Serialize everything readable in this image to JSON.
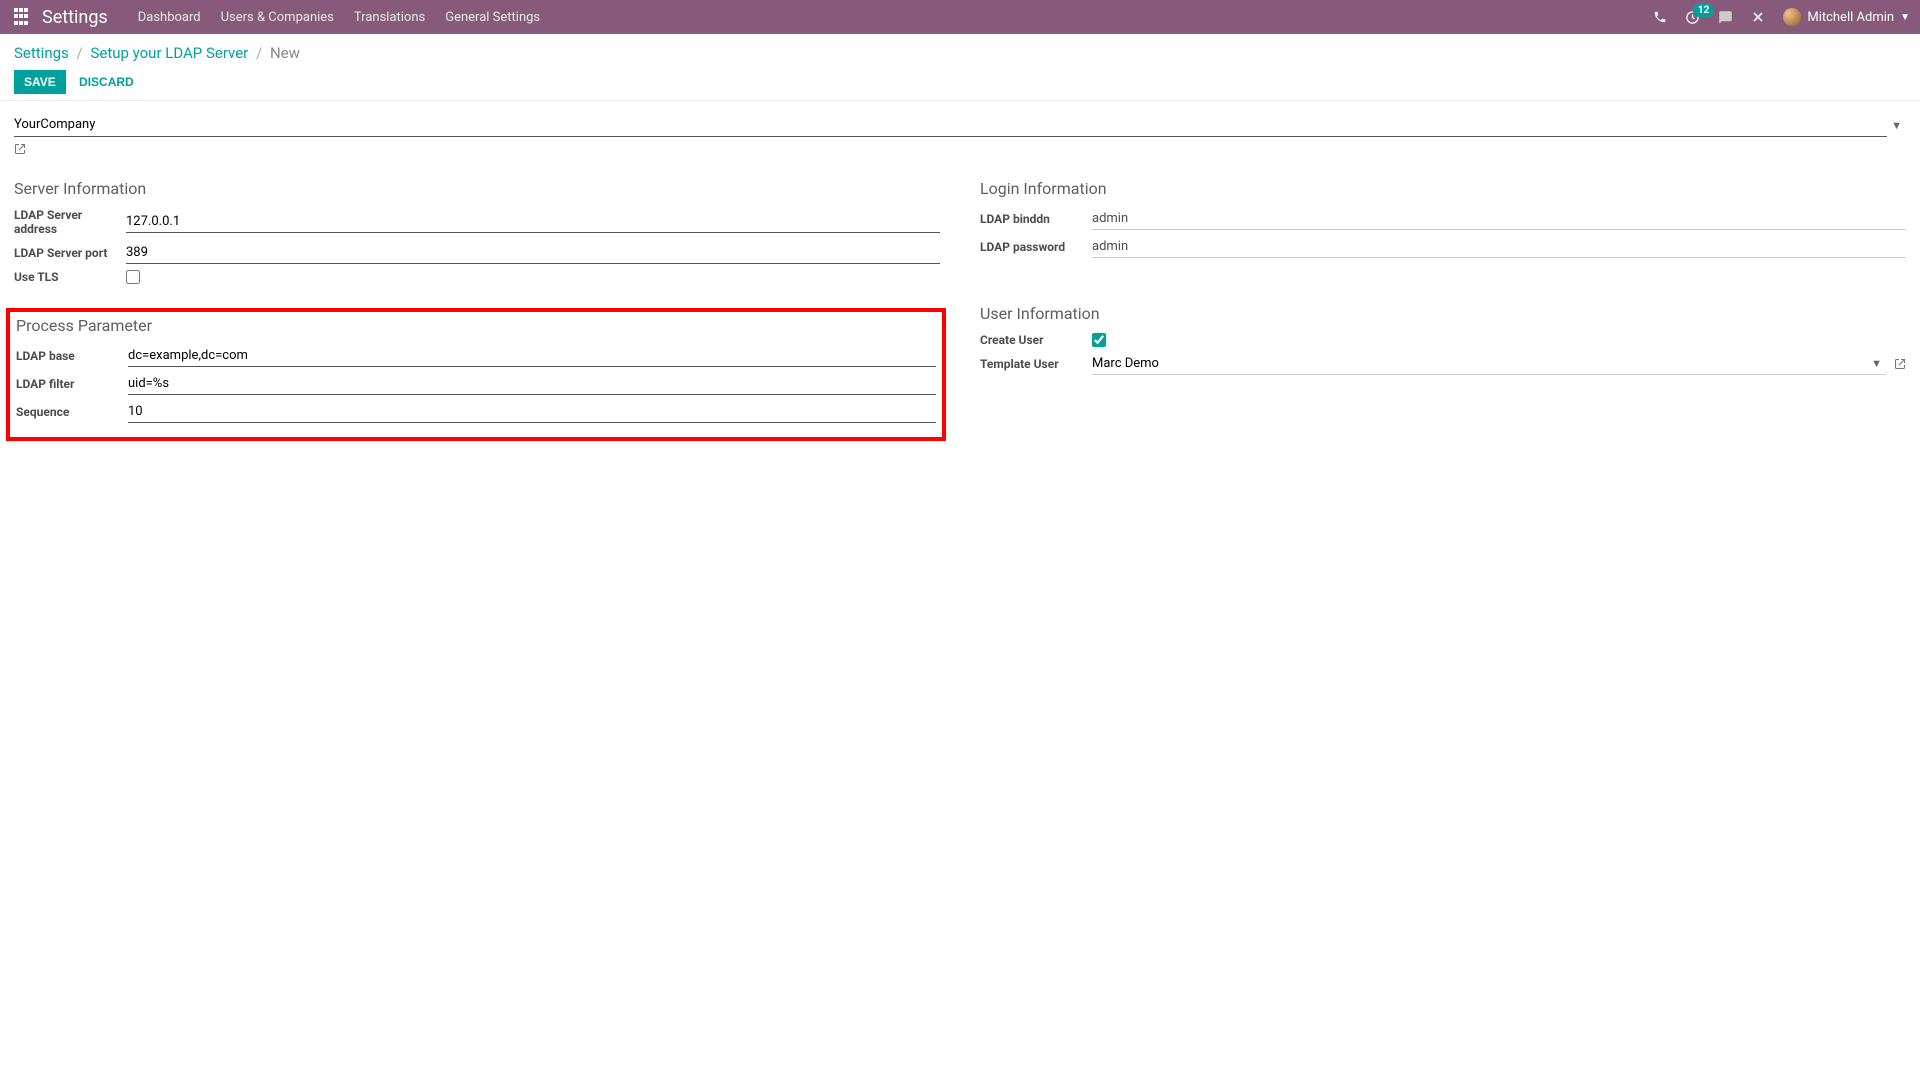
{
  "topnav": {
    "brand": "Settings",
    "links": [
      "Dashboard",
      "Users & Companies",
      "Translations",
      "General Settings"
    ],
    "activity_count": "12",
    "user_name": "Mitchell Admin"
  },
  "breadcrumb": {
    "root": "Settings",
    "parent": "Setup your LDAP Server",
    "current": "New"
  },
  "actions": {
    "save": "SAVE",
    "discard": "DISCARD"
  },
  "form": {
    "company": "YourCompany",
    "server_info": {
      "title": "Server Information",
      "address_label": "LDAP Server address",
      "address_value": "127.0.0.1",
      "port_label": "LDAP Server port",
      "port_value": "389",
      "tls_label": "Use TLS",
      "tls_checked": false
    },
    "login_info": {
      "title": "Login Information",
      "binddn_label": "LDAP binddn",
      "binddn_value": "admin",
      "password_label": "LDAP password",
      "password_value": "admin"
    },
    "process": {
      "title": "Process Parameter",
      "base_label": "LDAP base",
      "base_value": "dc=example,dc=com",
      "filter_label": "LDAP filter",
      "filter_value": "uid=%s",
      "sequence_label": "Sequence",
      "sequence_value": "10"
    },
    "user_info": {
      "title": "User Information",
      "create_user_label": "Create User",
      "create_user_checked": true,
      "template_user_label": "Template User",
      "template_user_value": "Marc Demo"
    }
  }
}
